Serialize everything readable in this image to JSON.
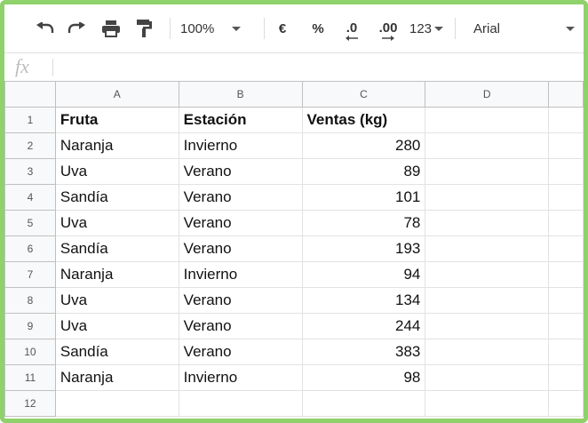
{
  "toolbar": {
    "zoom": "100%",
    "currency": "€",
    "percent": "%",
    "decrease_decimals": ".0",
    "increase_decimals": ".00",
    "more_formats": "123",
    "font": "Arial"
  },
  "formula_bar": {
    "fx_label": "fx",
    "value": ""
  },
  "columns": [
    "A",
    "B",
    "C",
    "D"
  ],
  "rows": [
    {
      "num": "1",
      "a": "Fruta",
      "b": "Estación",
      "c": "Ventas (kg)"
    },
    {
      "num": "2",
      "a": "Naranja",
      "b": "Invierno",
      "c": "280"
    },
    {
      "num": "3",
      "a": "Uva",
      "b": "Verano",
      "c": "89"
    },
    {
      "num": "4",
      "a": "Sandía",
      "b": "Verano",
      "c": "101"
    },
    {
      "num": "5",
      "a": "Uva",
      "b": "Verano",
      "c": "78"
    },
    {
      "num": "6",
      "a": "Sandía",
      "b": "Verano",
      "c": "193"
    },
    {
      "num": "7",
      "a": "Naranja",
      "b": "Invierno",
      "c": "94"
    },
    {
      "num": "8",
      "a": "Uva",
      "b": "Verano",
      "c": "134"
    },
    {
      "num": "9",
      "a": "Uva",
      "b": "Verano",
      "c": "244"
    },
    {
      "num": "10",
      "a": "Sandía",
      "b": "Verano",
      "c": "383"
    },
    {
      "num": "11",
      "a": "Naranja",
      "b": "Invierno",
      "c": "98"
    },
    {
      "num": "12",
      "a": "",
      "b": "",
      "c": ""
    }
  ],
  "icons": [
    "undo-icon",
    "redo-icon",
    "print-icon",
    "paint-format-icon",
    "dropdown-caret-icon"
  ],
  "colors": {
    "frame": "#8fd16a",
    "header_bg": "#f8f9fa"
  }
}
